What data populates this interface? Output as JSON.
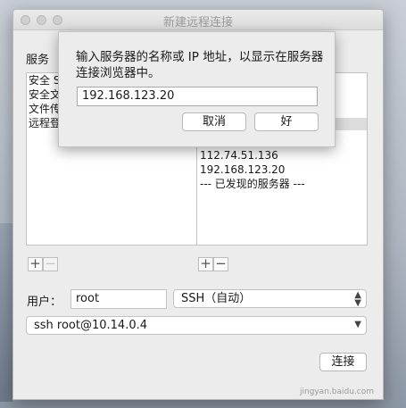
{
  "window": {
    "title": "新建远程连接"
  },
  "services": {
    "label": "服务",
    "items": [
      "安全 S",
      "安全文",
      "文件传",
      "远程登"
    ]
  },
  "servers": {
    "items": [
      "112.74.51.136",
      "192.168.123.20",
      "--- 已发现的服务器 ---"
    ]
  },
  "add_remove": {
    "add": "+",
    "remove": "−"
  },
  "user": {
    "label": "用户：",
    "value": "root"
  },
  "protocol": {
    "selected": "SSH（自动）"
  },
  "command": {
    "value": "ssh root@10.14.0.4"
  },
  "connect_button": "连接",
  "sheet": {
    "prompt": "输入服务器的名称或 IP 地址，以显示在服务器连接浏览器中。",
    "input_value": "192.168.123.20",
    "cancel_label": "取消",
    "ok_label": "好"
  },
  "watermark": "jingyan.baidu.com"
}
